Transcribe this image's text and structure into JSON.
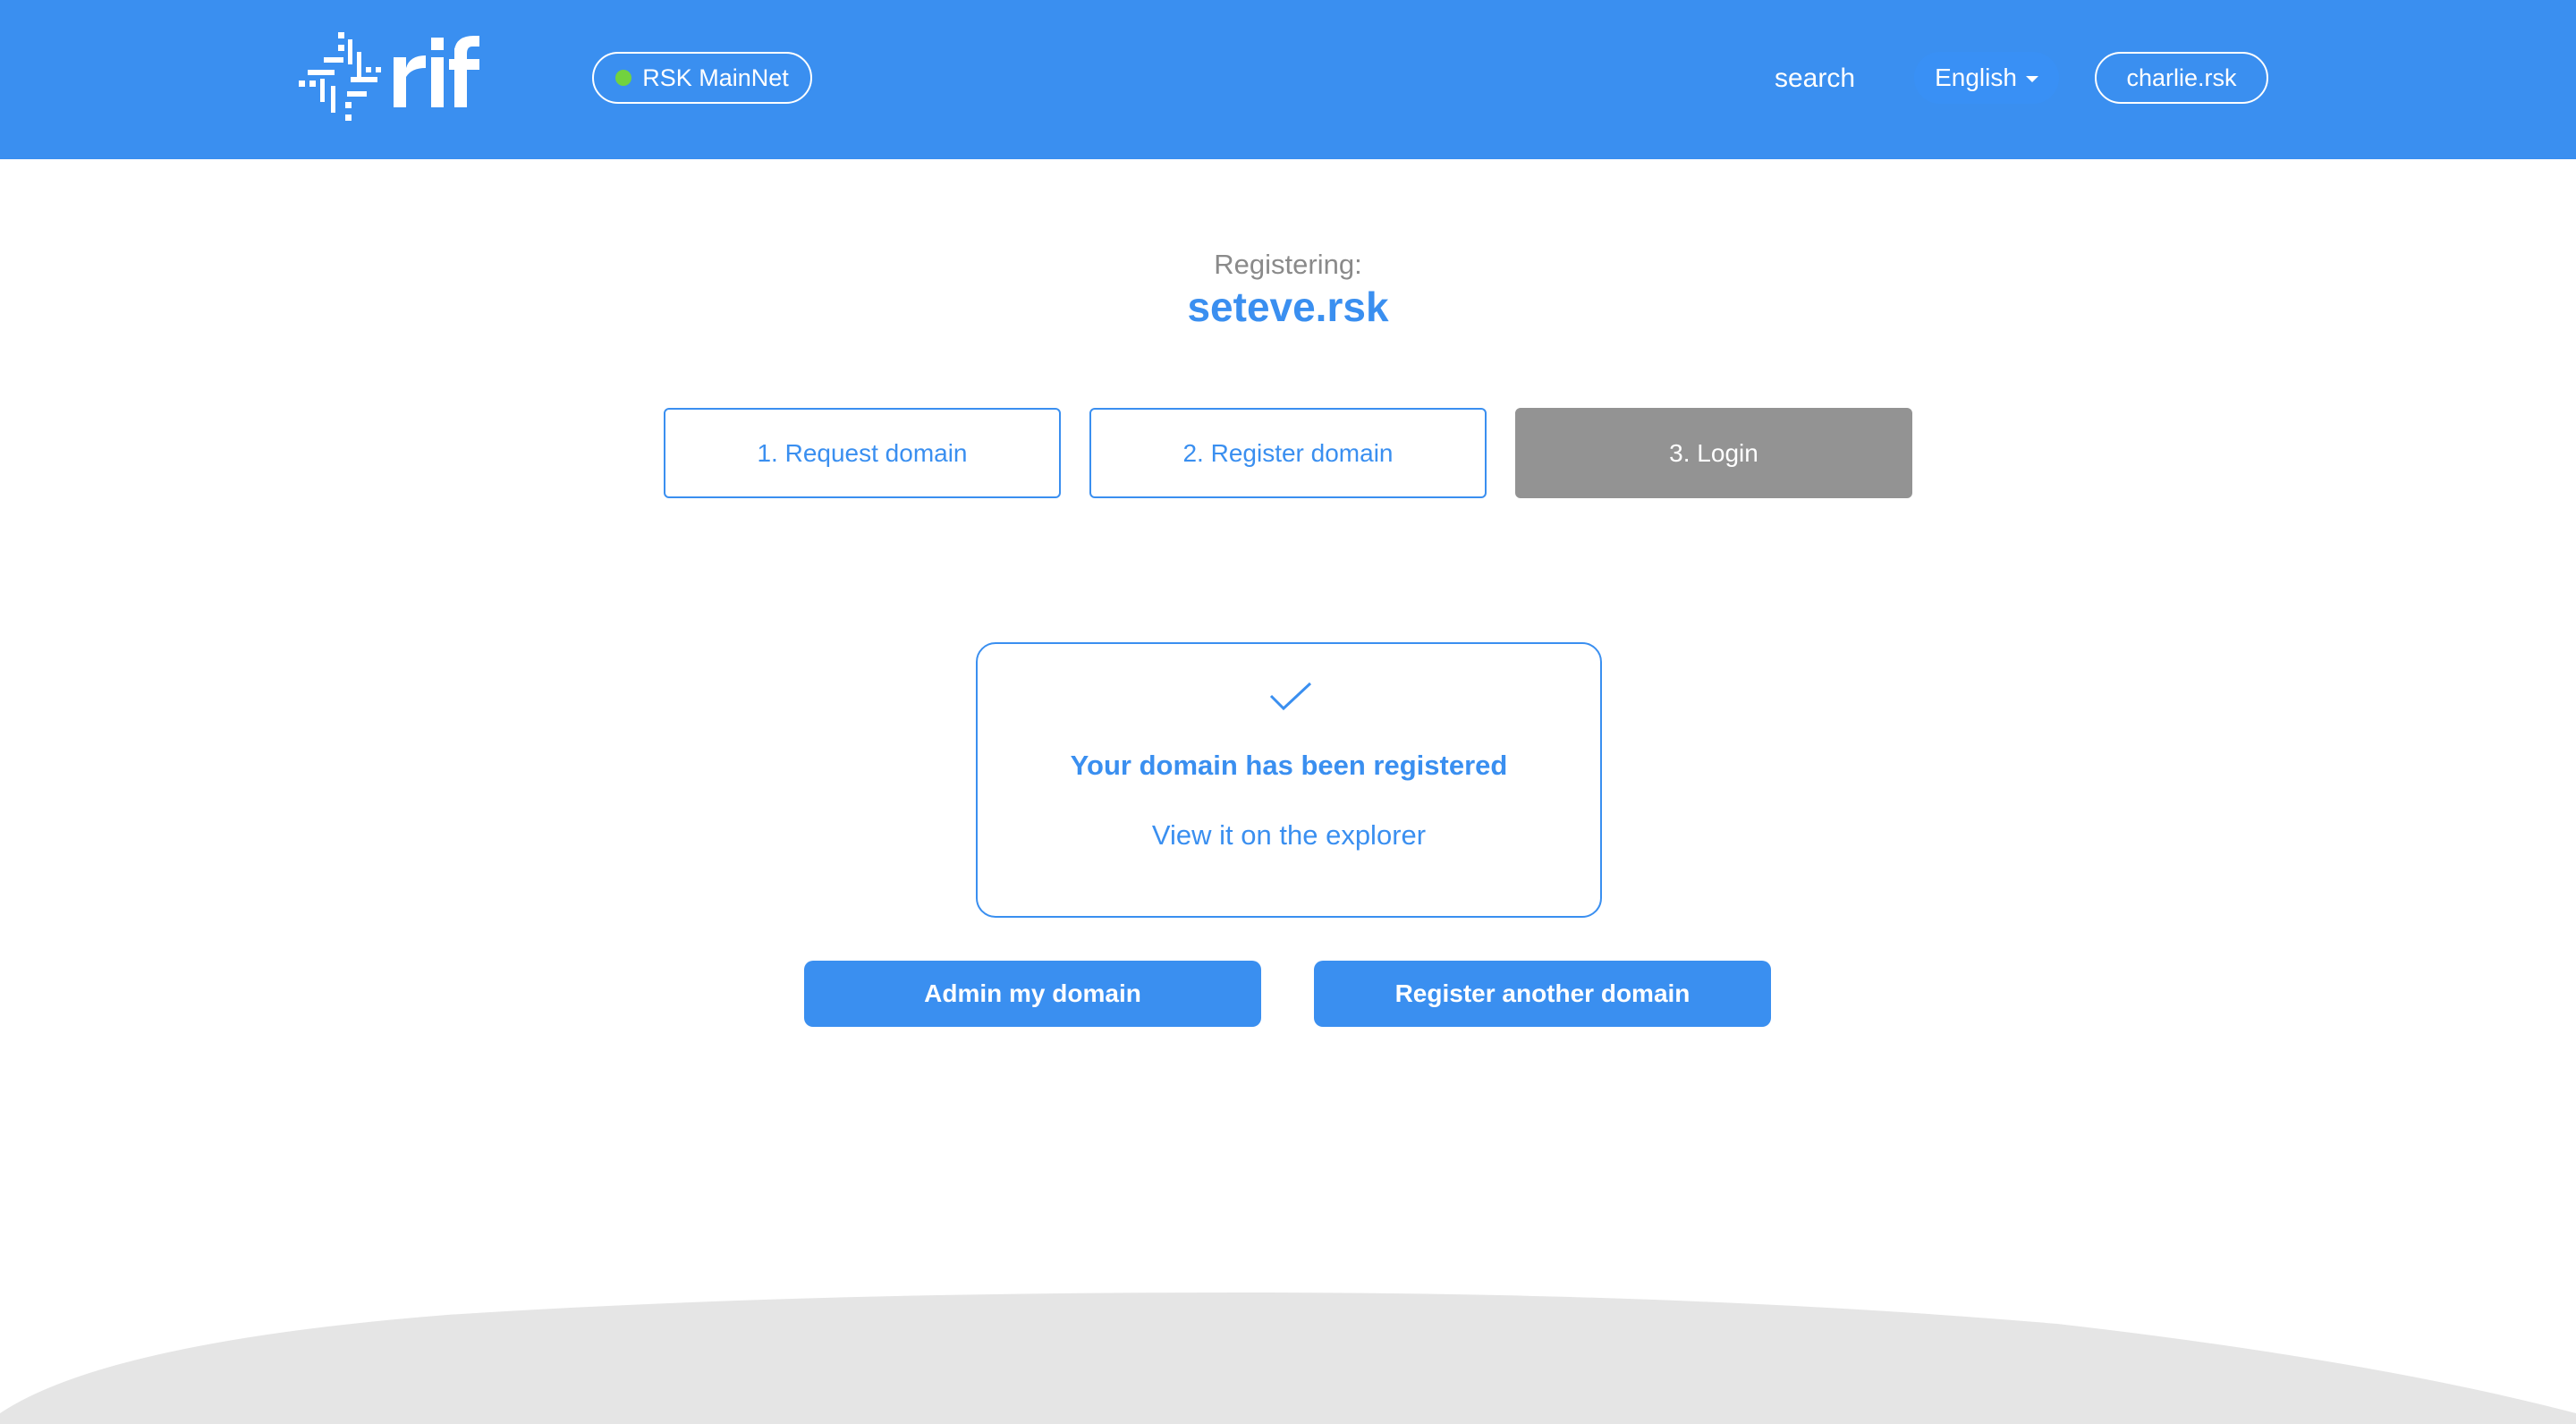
{
  "header": {
    "logo_text": "rif",
    "network": {
      "label": "RSK MainNet",
      "status_color": "#72d23f"
    },
    "search_label": "search",
    "language": {
      "selected": "English"
    },
    "user": {
      "label": "charlie.rsk"
    }
  },
  "registration": {
    "label": "Registering:",
    "domain": "seteve.rsk"
  },
  "steps": [
    {
      "label": "1. Request domain",
      "state": "completed"
    },
    {
      "label": "2. Register domain",
      "state": "completed"
    },
    {
      "label": "3. Login",
      "state": "current"
    }
  ],
  "success": {
    "icon": "check-icon",
    "title": "Your domain has been registered",
    "link_label": "View it on the explorer"
  },
  "actions": {
    "admin_label": "Admin my domain",
    "register_another_label": "Register another domain"
  },
  "colors": {
    "brand": "#3a8ff0",
    "step_current": "#939393",
    "footer": "#e5e5e5"
  }
}
